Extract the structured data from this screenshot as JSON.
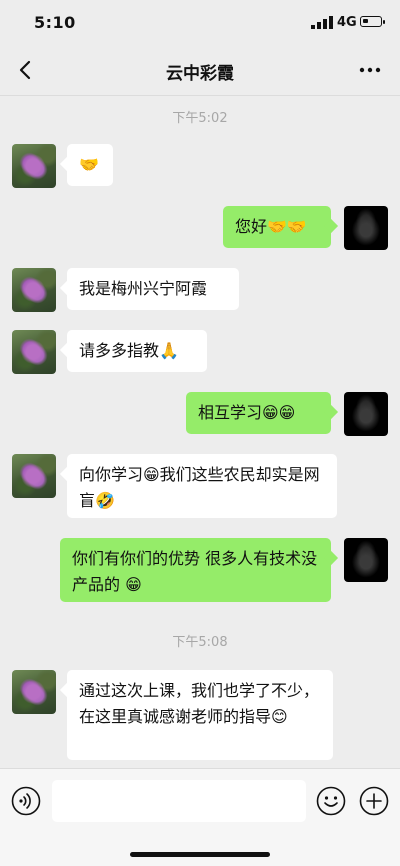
{
  "status_bar": {
    "time": "5:10",
    "network": "4G"
  },
  "nav": {
    "title": "云中彩霞"
  },
  "chat": {
    "timestamps": [
      "下午5:02",
      "下午5:08"
    ],
    "messages": [
      {
        "side": "left",
        "text": "🤝"
      },
      {
        "side": "right",
        "text": "您好🤝🤝"
      },
      {
        "side": "left",
        "text": "我是梅州兴宁阿霞"
      },
      {
        "side": "left",
        "text": "请多多指教🙏"
      },
      {
        "side": "right",
        "text": "相互学习😁😁"
      },
      {
        "side": "left",
        "text": "向你学习😁我们这些农民却实是网盲🤣"
      },
      {
        "side": "right",
        "text": "你们有你们的优势 很多人有技术没产品的 😁"
      },
      {
        "side": "left",
        "text": "通过这次上课，我们也学了不少，在这里真诚感谢老师的指导😊"
      }
    ]
  },
  "input_bar": {
    "placeholder": ""
  }
}
